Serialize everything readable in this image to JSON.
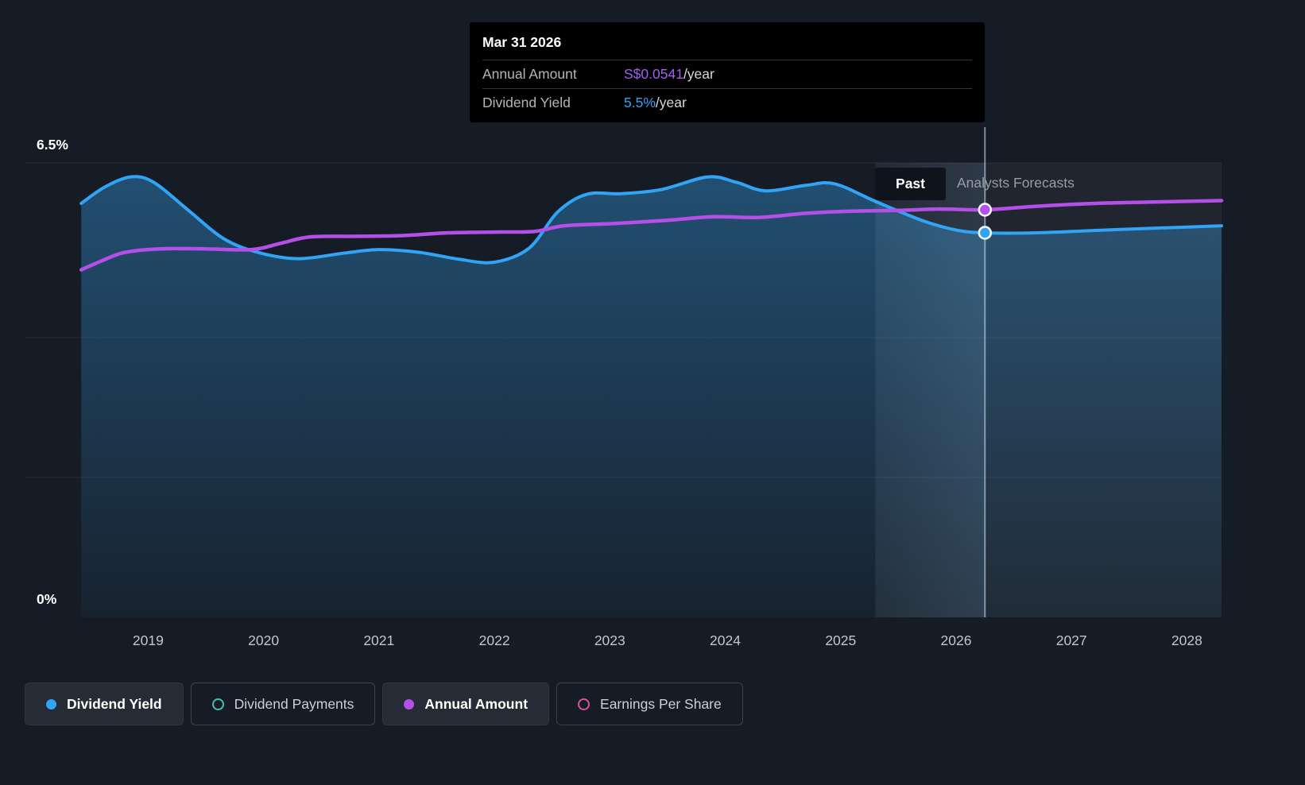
{
  "page": {
    "bg": "#161c26"
  },
  "tooltip": {
    "date": "Mar 31 2026",
    "rows": [
      {
        "label": "Annual Amount",
        "value": "S$0.0541",
        "suffix": "/year",
        "value_color": "#a65cf3"
      },
      {
        "label": "Dividend Yield",
        "value": "5.5%",
        "suffix": "/year",
        "value_color": "#31a4f5"
      }
    ]
  },
  "axes": {
    "y_top_label": "6.5%",
    "y_bottom_label": "0%"
  },
  "regions": {
    "past_label": "Past",
    "forecast_label": "Analysts Forecasts"
  },
  "legend": [
    {
      "label": "Dividend Yield",
      "marker": "dot",
      "color": "#31a4f5",
      "active": true
    },
    {
      "label": "Dividend Payments",
      "marker": "ring",
      "color": "#3fc3b1",
      "active": false
    },
    {
      "label": "Annual Amount",
      "marker": "dot",
      "color": "#b44fe8",
      "active": true
    },
    {
      "label": "Earnings Per Share",
      "marker": "ring",
      "color": "#dd4f9e",
      "active": false
    }
  ],
  "chart_data": {
    "type": "area",
    "x_domain": [
      2018.35,
      2028.3
    ],
    "y_domain_percent": [
      0,
      6.5
    ],
    "x_ticks": [
      2019,
      2020,
      2021,
      2022,
      2023,
      2024,
      2025,
      2026,
      2027,
      2028
    ],
    "gridline_values": [
      6.5,
      4,
      2
    ],
    "past_forecast_boundary_x": 2025.3,
    "hover": {
      "x_value": 2026.25,
      "date": "Mar 31 2026",
      "dividend_yield_percent": 5.5,
      "annual_amount_label": "S$0.0541/year",
      "amount_plot_percent": 5.83
    },
    "annual_amount_axis_note": "Annual Amount is plotted on a hidden scale; only the hovered value S$0.0541/year at Mar 31 2026 is shown on screen.",
    "series": [
      {
        "name": "Dividend Yield",
        "color": "#31a4f5",
        "style": "line-area",
        "unit": "percent",
        "points": [
          [
            2018.42,
            5.92
          ],
          [
            2018.62,
            6.15
          ],
          [
            2018.85,
            6.3
          ],
          [
            2019.05,
            6.22
          ],
          [
            2019.35,
            5.82
          ],
          [
            2019.65,
            5.42
          ],
          [
            2019.95,
            5.22
          ],
          [
            2020.3,
            5.13
          ],
          [
            2020.7,
            5.21
          ],
          [
            2021.0,
            5.26
          ],
          [
            2021.35,
            5.22
          ],
          [
            2021.7,
            5.12
          ],
          [
            2022.0,
            5.08
          ],
          [
            2022.3,
            5.28
          ],
          [
            2022.55,
            5.8
          ],
          [
            2022.8,
            6.05
          ],
          [
            2023.1,
            6.06
          ],
          [
            2023.45,
            6.12
          ],
          [
            2023.85,
            6.3
          ],
          [
            2024.1,
            6.22
          ],
          [
            2024.35,
            6.1
          ],
          [
            2024.7,
            6.18
          ],
          [
            2024.95,
            6.2
          ],
          [
            2025.3,
            5.95
          ],
          [
            2025.7,
            5.68
          ],
          [
            2026.0,
            5.54
          ],
          [
            2026.25,
            5.5
          ],
          [
            2026.7,
            5.5
          ],
          [
            2027.3,
            5.54
          ],
          [
            2027.8,
            5.57
          ],
          [
            2028.3,
            5.6
          ]
        ]
      },
      {
        "name": "Annual Amount",
        "color": "#b44fe8",
        "style": "line",
        "unit": "plotted-on-yield-axis",
        "points": [
          [
            2018.42,
            4.97
          ],
          [
            2018.6,
            5.1
          ],
          [
            2018.8,
            5.22
          ],
          [
            2019.1,
            5.27
          ],
          [
            2019.5,
            5.27
          ],
          [
            2019.9,
            5.26
          ],
          [
            2020.15,
            5.35
          ],
          [
            2020.4,
            5.44
          ],
          [
            2020.8,
            5.45
          ],
          [
            2021.2,
            5.46
          ],
          [
            2021.6,
            5.5
          ],
          [
            2022.0,
            5.51
          ],
          [
            2022.35,
            5.52
          ],
          [
            2022.6,
            5.6
          ],
          [
            2023.0,
            5.63
          ],
          [
            2023.5,
            5.68
          ],
          [
            2023.9,
            5.73
          ],
          [
            2024.3,
            5.72
          ],
          [
            2024.7,
            5.78
          ],
          [
            2025.1,
            5.81
          ],
          [
            2025.5,
            5.82
          ],
          [
            2025.85,
            5.84
          ],
          [
            2026.25,
            5.83
          ],
          [
            2026.7,
            5.88
          ],
          [
            2027.2,
            5.92
          ],
          [
            2027.7,
            5.94
          ],
          [
            2028.3,
            5.96
          ]
        ]
      }
    ]
  }
}
